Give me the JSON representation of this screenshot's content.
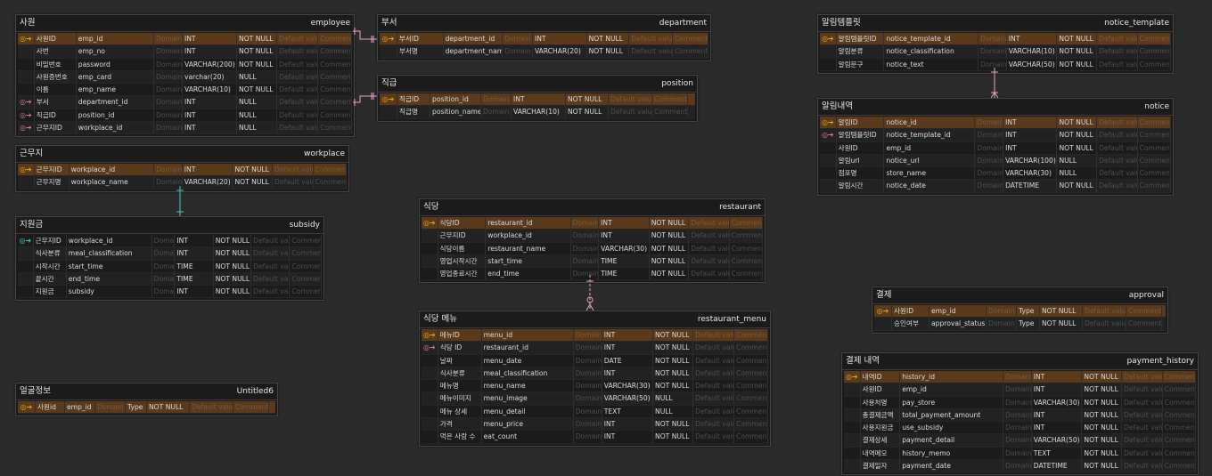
{
  "tables": [
    {
      "id": "employee",
      "logical": "사원",
      "physical": "employee",
      "rows": [
        {
          "key": "pk",
          "lname": "사원ID",
          "pname": "emp_id",
          "domain": "Domain",
          "type": "INT",
          "nn": "NOT NULL",
          "def": "Default value",
          "cmt": "Comment"
        },
        {
          "key": "",
          "lname": "사번",
          "pname": "emp_no",
          "domain": "Domain",
          "type": "INT",
          "nn": "NOT NULL",
          "def": "Default value",
          "cmt": "Comment"
        },
        {
          "key": "",
          "lname": "비밀번호",
          "pname": "password",
          "domain": "Domain",
          "type": "VARCHAR(200)",
          "nn": "NOT NULL",
          "def": "Default value",
          "cmt": "Comment"
        },
        {
          "key": "",
          "lname": "사원증번호",
          "pname": "emp_card",
          "domain": "Domain",
          "type": "varchar(20)",
          "nn": "NULL",
          "def": "Default value",
          "cmt": "Comment"
        },
        {
          "key": "",
          "lname": "이름",
          "pname": "emp_name",
          "domain": "Domain",
          "type": "VARCHAR(10)",
          "nn": "NOT NULL",
          "def": "Default value",
          "cmt": "Comment"
        },
        {
          "key": "fk",
          "lname": "부서",
          "pname": "department_id",
          "domain": "Domain",
          "type": "INT",
          "nn": "NULL",
          "def": "Default value",
          "cmt": "Comment"
        },
        {
          "key": "fk",
          "lname": "직급ID",
          "pname": "position_id",
          "domain": "Domain",
          "type": "INT",
          "nn": "NULL",
          "def": "Default value",
          "cmt": "Comment"
        },
        {
          "key": "fk",
          "lname": "근무지ID",
          "pname": "workplace_id",
          "domain": "Domain",
          "type": "INT",
          "nn": "NULL",
          "def": "Default value",
          "cmt": "Comment"
        }
      ]
    },
    {
      "id": "department",
      "logical": "부서",
      "physical": "department",
      "rows": [
        {
          "key": "pk",
          "lname": "부서ID",
          "pname": "department_id",
          "domain": "Domain",
          "type": "INT",
          "nn": "NOT NULL",
          "def": "Default value",
          "cmt": "Comment"
        },
        {
          "key": "",
          "lname": "부서명",
          "pname": "department_name",
          "domain": "Domain",
          "type": "VARCHAR(20)",
          "nn": "NOT NULL",
          "def": "Default value",
          "cmt": "Comment"
        }
      ]
    },
    {
      "id": "position",
      "logical": "직급",
      "physical": "position",
      "rows": [
        {
          "key": "pk",
          "lname": "직급ID",
          "pname": "position_id",
          "domain": "Domain",
          "type": "INT",
          "nn": "NOT NULL",
          "def": "Default value",
          "cmt": "Comment"
        },
        {
          "key": "",
          "lname": "직급명",
          "pname": "position_name",
          "domain": "Domain",
          "type": "VARCHAR(10)",
          "nn": "NOT NULL",
          "def": "Default value",
          "cmt": "Comment"
        }
      ]
    },
    {
      "id": "notice_template",
      "logical": "알림템플릿",
      "physical": "notice_template",
      "rows": [
        {
          "key": "pk",
          "lname": "알림템플릿ID",
          "pname": "notice_template_id",
          "domain": "Domain",
          "type": "INT",
          "nn": "NOT NULL",
          "def": "Default value",
          "cmt": "Comment"
        },
        {
          "key": "",
          "lname": "알림분류",
          "pname": "notice_classification",
          "domain": "Domain",
          "type": "VARCHAR(10)",
          "nn": "NOT NULL",
          "def": "Default value",
          "cmt": "Comment"
        },
        {
          "key": "",
          "lname": "알림문구",
          "pname": "notice_text",
          "domain": "Domain",
          "type": "VARCHAR(50)",
          "nn": "NOT NULL",
          "def": "Default value",
          "cmt": "Comment"
        }
      ]
    },
    {
      "id": "notice",
      "logical": "알림내역",
      "physical": "notice",
      "rows": [
        {
          "key": "pk",
          "lname": "알림ID",
          "pname": "notice_id",
          "domain": "Domain",
          "type": "INT",
          "nn": "NOT NULL",
          "def": "Default value",
          "cmt": "Comment"
        },
        {
          "key": "fk",
          "lname": "알림템플릿ID",
          "pname": "notice_template_id",
          "domain": "Domain",
          "type": "INT",
          "nn": "NOT NULL",
          "def": "Default value",
          "cmt": "Comment"
        },
        {
          "key": "",
          "lname": "사원ID",
          "pname": "emp_id",
          "domain": "Domain",
          "type": "INT",
          "nn": "NOT NULL",
          "def": "Default value",
          "cmt": "Comment"
        },
        {
          "key": "",
          "lname": "알림url",
          "pname": "notice_url",
          "domain": "Domain",
          "type": "VARCHAR(100)",
          "nn": "NULL",
          "def": "Default value",
          "cmt": "Comment"
        },
        {
          "key": "",
          "lname": "점포명",
          "pname": "store_name",
          "domain": "Domain",
          "type": "VARCHAR(30)",
          "nn": "NULL",
          "def": "Default value",
          "cmt": "Comment"
        },
        {
          "key": "",
          "lname": "알림시간",
          "pname": "notice_date",
          "domain": "Domain",
          "type": "DATETIME",
          "nn": "NOT NULL",
          "def": "Default value",
          "cmt": "Comment"
        }
      ]
    },
    {
      "id": "workplace",
      "logical": "근무지",
      "physical": "workplace",
      "rows": [
        {
          "key": "pk",
          "lname": "근무지ID",
          "pname": "workplace_id",
          "domain": "Domain",
          "type": "INT",
          "nn": "NOT NULL",
          "def": "Default value",
          "cmt": "Comment"
        },
        {
          "key": "",
          "lname": "근무지명",
          "pname": "workplace_name",
          "domain": "Domain",
          "type": "VARCHAR(20)",
          "nn": "NOT NULL",
          "def": "Default value",
          "cmt": "Comment"
        }
      ]
    },
    {
      "id": "subsidy",
      "logical": "지원금",
      "physical": "subsidy",
      "rows": [
        {
          "key": "pfk",
          "lname": "근무지ID",
          "pname": "workplace_id",
          "domain": "Domain",
          "type": "INT",
          "nn": "NOT NULL",
          "def": "Default value",
          "cmt": "Comment"
        },
        {
          "key": "",
          "lname": "식사분류",
          "pname": "meal_classification",
          "domain": "Domain",
          "type": "INT",
          "nn": "NOT NULL",
          "def": "Default value",
          "cmt": "Comment"
        },
        {
          "key": "",
          "lname": "시작시간",
          "pname": "start_time",
          "domain": "Domain",
          "type": "TIME",
          "nn": "NOT NULL",
          "def": "Default value",
          "cmt": "Comment"
        },
        {
          "key": "",
          "lname": "끝시간",
          "pname": "end_time",
          "domain": "Domain",
          "type": "TIME",
          "nn": "NOT NULL",
          "def": "Default value",
          "cmt": "Comment"
        },
        {
          "key": "",
          "lname": "지원금",
          "pname": "subsidy",
          "domain": "Domain",
          "type": "INT",
          "nn": "NOT NULL",
          "def": "Default value",
          "cmt": "Comment"
        }
      ]
    },
    {
      "id": "restaurant",
      "logical": "식당",
      "physical": "restaurant",
      "rows": [
        {
          "key": "pk",
          "lname": "식당ID",
          "pname": "restaurant_id",
          "domain": "Domain",
          "type": "INT",
          "nn": "NOT NULL",
          "def": "Default value",
          "cmt": "Comment"
        },
        {
          "key": "",
          "lname": "근무지ID",
          "pname": "workplace_id",
          "domain": "Domain",
          "type": "INT",
          "nn": "NOT NULL",
          "def": "Default value",
          "cmt": "Comment"
        },
        {
          "key": "",
          "lname": "식당이름",
          "pname": "restaurant_name",
          "domain": "Domain",
          "type": "VARCHAR(30)",
          "nn": "NOT NULL",
          "def": "Default value",
          "cmt": "Comment"
        },
        {
          "key": "",
          "lname": "영업시작시간",
          "pname": "start_time",
          "domain": "Domain",
          "type": "TIME",
          "nn": "NOT NULL",
          "def": "Default value",
          "cmt": "Comment"
        },
        {
          "key": "",
          "lname": "영업종료시간",
          "pname": "end_time",
          "domain": "Domain",
          "type": "TIME",
          "nn": "NOT NULL",
          "def": "Default value",
          "cmt": "Comment"
        }
      ]
    },
    {
      "id": "restaurant_menu",
      "logical": "식당 메뉴",
      "physical": "restaurant_menu",
      "rows": [
        {
          "key": "pk",
          "lname": "메뉴ID",
          "pname": "menu_id",
          "domain": "Domain",
          "type": "INT",
          "nn": "NOT NULL",
          "def": "Default value",
          "cmt": "Comment"
        },
        {
          "key": "fk",
          "lname": "식당 ID",
          "pname": "restaurant_id",
          "domain": "Domain",
          "type": "INT",
          "nn": "NOT NULL",
          "def": "Default value",
          "cmt": "Comment"
        },
        {
          "key": "",
          "lname": "날짜",
          "pname": "menu_date",
          "domain": "Domain",
          "type": "DATE",
          "nn": "NOT NULL",
          "def": "Default value",
          "cmt": "Comment"
        },
        {
          "key": "",
          "lname": "식사분류",
          "pname": "meal_classification",
          "domain": "Domain",
          "type": "INT",
          "nn": "NOT NULL",
          "def": "Default value",
          "cmt": "Comment"
        },
        {
          "key": "",
          "lname": "메뉴명",
          "pname": "menu_name",
          "domain": "Domain",
          "type": "VARCHAR(30)",
          "nn": "NOT NULL",
          "def": "Default value",
          "cmt": "Comment"
        },
        {
          "key": "",
          "lname": "메뉴이미지",
          "pname": "menu_image",
          "domain": "Domain",
          "type": "VARCHAR(50)",
          "nn": "NULL",
          "def": "Default value",
          "cmt": "Comment"
        },
        {
          "key": "",
          "lname": "메뉴 상세",
          "pname": "menu_detail",
          "domain": "Domain",
          "type": "TEXT",
          "nn": "NULL",
          "def": "Default value",
          "cmt": "Comment"
        },
        {
          "key": "",
          "lname": "가격",
          "pname": "menu_price",
          "domain": "Domain",
          "type": "INT",
          "nn": "NOT NULL",
          "def": "Default value",
          "cmt": "Comment"
        },
        {
          "key": "",
          "lname": "먹은 사람 수",
          "pname": "eat_count",
          "domain": "Domain",
          "type": "INT",
          "nn": "NOT NULL",
          "def": "Default value",
          "cmt": "Comment"
        }
      ]
    },
    {
      "id": "approval",
      "logical": "결제",
      "physical": "approval",
      "rows": [
        {
          "key": "pk",
          "lname": "사원ID",
          "pname": "emp_id",
          "domain": "Domain",
          "type": "Type",
          "nn": "NOT NULL",
          "def": "Default value",
          "cmt": "Comment"
        },
        {
          "key": "",
          "lname": "승인여부",
          "pname": "approval_status",
          "domain": "Domain",
          "type": "Type",
          "nn": "NOT NULL",
          "def": "Default value",
          "cmt": "Comment"
        }
      ]
    },
    {
      "id": "payment_history",
      "logical": "결제 내역",
      "physical": "payment_history",
      "rows": [
        {
          "key": "pk",
          "lname": "내역ID",
          "pname": "history_id",
          "domain": "Domain",
          "type": "INT",
          "nn": "NOT NULL",
          "def": "Default value",
          "cmt": "Comment"
        },
        {
          "key": "",
          "lname": "사원ID",
          "pname": "emp_id",
          "domain": "Domain",
          "type": "INT",
          "nn": "NOT NULL",
          "def": "Default value",
          "cmt": "Comment"
        },
        {
          "key": "",
          "lname": "사용처명",
          "pname": "pay_store",
          "domain": "Domain",
          "type": "VARCHAR(30)",
          "nn": "NOT NULL",
          "def": "Default value",
          "cmt": "Comment"
        },
        {
          "key": "",
          "lname": "총결제금액",
          "pname": "total_payment_amount",
          "domain": "Domain",
          "type": "INT",
          "nn": "NOT NULL",
          "def": "Default value",
          "cmt": "Comment"
        },
        {
          "key": "",
          "lname": "사용지원금",
          "pname": "use_subsidy",
          "domain": "Domain",
          "type": "INT",
          "nn": "NOT NULL",
          "def": "Default value",
          "cmt": "Comment"
        },
        {
          "key": "",
          "lname": "결제상세",
          "pname": "payment_detail",
          "domain": "Domain",
          "type": "VARCHAR(50)",
          "nn": "NOT NULL",
          "def": "Default value",
          "cmt": "Comment"
        },
        {
          "key": "",
          "lname": "내역메모",
          "pname": "history_memo",
          "domain": "Domain",
          "type": "TEXT",
          "nn": "NOT NULL",
          "def": "Default value",
          "cmt": "Comment"
        },
        {
          "key": "",
          "lname": "결제일자",
          "pname": "payment_date",
          "domain": "Domain",
          "type": "DATETIME",
          "nn": "NOT NULL",
          "def": "Default value",
          "cmt": "Comment"
        }
      ]
    },
    {
      "id": "untitled6",
      "logical": "얼굴정보",
      "physical": "Untitled6",
      "rows": [
        {
          "key": "pk",
          "lname": "사원id",
          "pname": "emp_id",
          "domain": "Domain",
          "type": "Type",
          "nn": "NOT NULL",
          "def": "Default value",
          "cmt": "Comment"
        }
      ]
    }
  ],
  "colors": {
    "background": "#2b2b2b",
    "table_bg": "#1b1b1b",
    "pk_row": "#5a3a1b",
    "pk_key": "#e0a51a",
    "fk_key": "#d07aa0",
    "pfk_key": "#4cc4c4",
    "rel_pink": "#e8a0c0",
    "rel_cyan": "#4cc4c4"
  },
  "icons": {
    "pk": "primary-key-icon",
    "fk": "foreign-key-icon",
    "pfk": "primary-foreign-key-icon"
  }
}
